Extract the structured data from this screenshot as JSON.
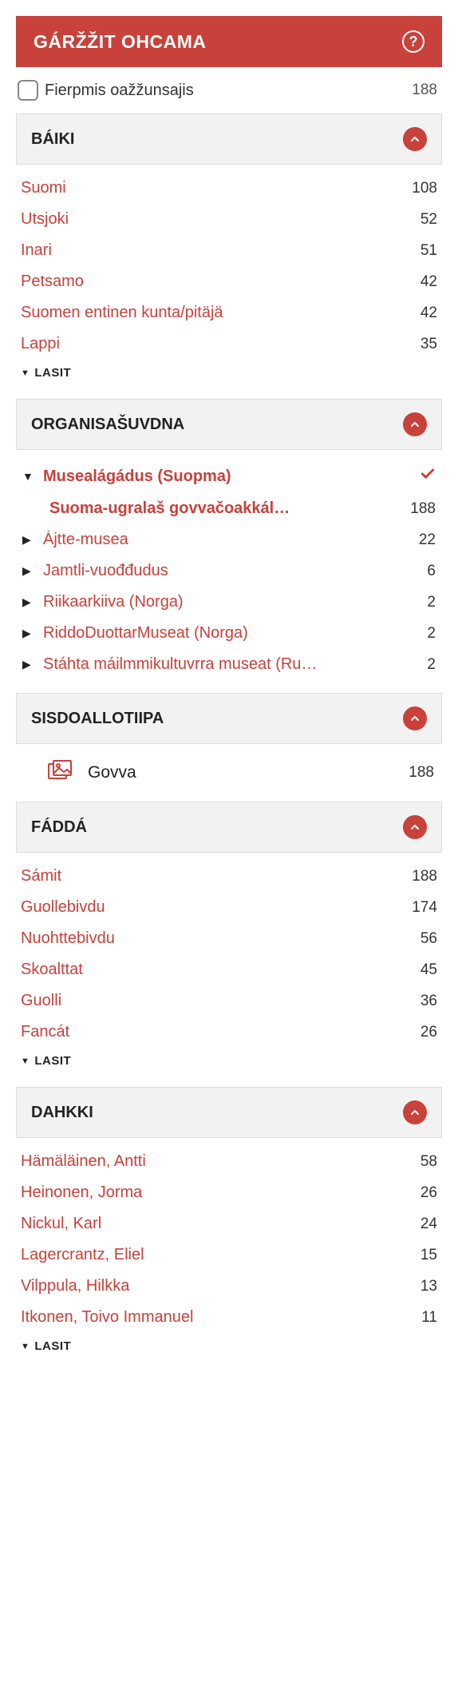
{
  "header": {
    "title": "GÁRŽŽIT OHCAMA"
  },
  "online": {
    "label": "Fierpmis oažžunsajis",
    "count": "188"
  },
  "lasit_label": "LASIT",
  "sections": {
    "baiki": {
      "title": "BÁIKI",
      "items": [
        {
          "label": "Suomi",
          "count": "108"
        },
        {
          "label": "Utsjoki",
          "count": "52"
        },
        {
          "label": "Inari",
          "count": "51"
        },
        {
          "label": "Petsamo",
          "count": "42"
        },
        {
          "label": "Suomen entinen kunta/pitäjä",
          "count": "42"
        },
        {
          "label": "Lappi",
          "count": "35"
        }
      ]
    },
    "org": {
      "title": "ORGANISAŠUVDNA",
      "expanded": {
        "label": "Musealágádus (Suopma)",
        "child": {
          "label": "Suoma-ugralaš govvačoakkál…",
          "count": "188"
        }
      },
      "items": [
        {
          "label": "Ájtte-musea",
          "count": "22"
        },
        {
          "label": "Jamtli-vuođđudus",
          "count": "6"
        },
        {
          "label": "Riikaarkiiva (Norga)",
          "count": "2"
        },
        {
          "label": "RiddoDuottarMuseat (Norga)",
          "count": "2"
        },
        {
          "label": "Stáhta máilmmikultuvrra museat (Ru…",
          "count": "2"
        }
      ]
    },
    "content": {
      "title": "SISDOALLOTIIPA",
      "item": {
        "label": "Govva",
        "count": "188"
      }
    },
    "fadda": {
      "title": "FÁDDÁ",
      "items": [
        {
          "label": "Sámit",
          "count": "188"
        },
        {
          "label": "Guollebivdu",
          "count": "174"
        },
        {
          "label": "Nuohttebivdu",
          "count": "56"
        },
        {
          "label": "Skoalttat",
          "count": "45"
        },
        {
          "label": "Guolli",
          "count": "36"
        },
        {
          "label": "Fancát",
          "count": "26"
        }
      ]
    },
    "dahkki": {
      "title": "DAHKKI",
      "items": [
        {
          "label": "Hämäläinen, Antti",
          "count": "58"
        },
        {
          "label": "Heinonen, Jorma",
          "count": "26"
        },
        {
          "label": "Nickul, Karl",
          "count": "24"
        },
        {
          "label": "Lagercrantz, Eliel",
          "count": "15"
        },
        {
          "label": "Vilppula, Hilkka",
          "count": "13"
        },
        {
          "label": "Itkonen, Toivo Immanuel",
          "count": "11"
        }
      ]
    }
  }
}
